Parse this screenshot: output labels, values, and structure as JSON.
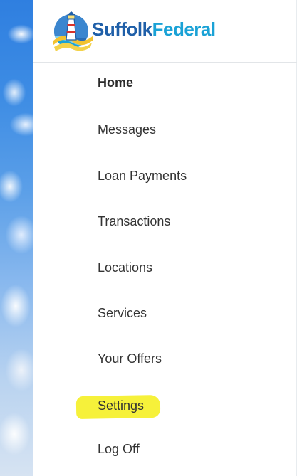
{
  "brand": {
    "name_part1": "Suffolk",
    "name_part2": "Federal",
    "logo_icon": "lighthouse-icon",
    "colors": {
      "primary": "#1f5fa8",
      "secondary": "#1aa2d6"
    }
  },
  "nav": {
    "items": [
      {
        "label": "Home",
        "active": true
      },
      {
        "label": "Messages"
      },
      {
        "label": "Loan Payments"
      },
      {
        "label": "Transactions"
      },
      {
        "label": "Locations"
      },
      {
        "label": "Services"
      },
      {
        "label": "Your Offers"
      },
      {
        "label": "Settings",
        "highlighted": true
      },
      {
        "label": "Log Off"
      }
    ]
  },
  "highlight_color": "#f6f13a"
}
